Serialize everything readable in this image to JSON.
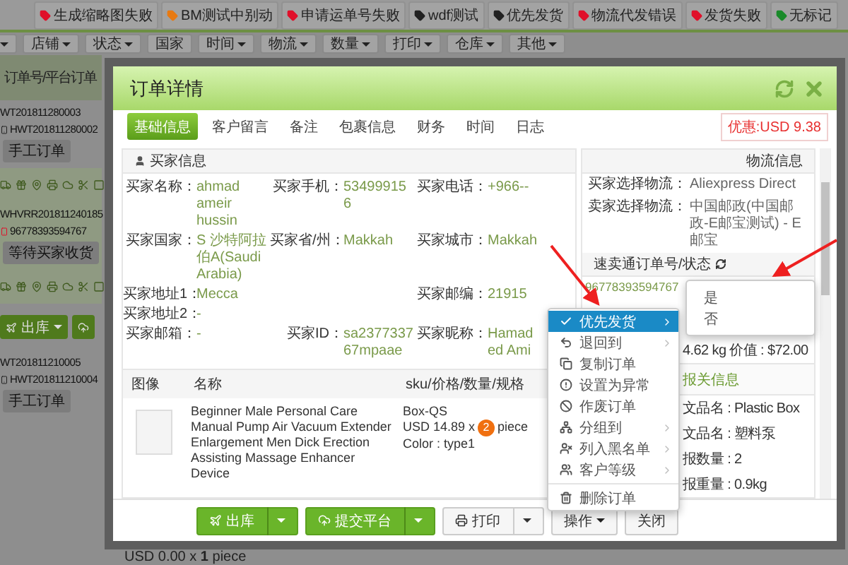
{
  "tags": [
    {
      "label": "生成缩略图失败",
      "color": "#e0102a"
    },
    {
      "label": "BM测试中别动",
      "color": "#e87a12"
    },
    {
      "label": "申请运单号失败",
      "color": "#e0102a"
    },
    {
      "label": "wdf测试",
      "color": "#222222"
    },
    {
      "label": "优先发货",
      "color": "#222222"
    },
    {
      "label": "物流代发错误",
      "color": "#e0102a"
    },
    {
      "label": "发货失败",
      "color": "#e0102a"
    },
    {
      "label": "无标记",
      "color": "#1a8a2a"
    }
  ],
  "filters": [
    {
      "has_menu": true
    },
    {
      "label": "店铺",
      "has_menu": true
    },
    {
      "label": "状态",
      "has_menu": true
    },
    {
      "label": "国家",
      "has_menu": false
    },
    {
      "label": "时间",
      "has_menu": true
    },
    {
      "label": "物流",
      "has_menu": true
    },
    {
      "label": "数量",
      "has_menu": true
    },
    {
      "label": "打印",
      "has_menu": true
    },
    {
      "label": "仓库",
      "has_menu": true
    },
    {
      "label": "其他",
      "has_menu": true
    }
  ],
  "order_list": {
    "header": "订单号/平台订单",
    "items": [
      {
        "kind": "order",
        "order_no": "WT201811280003",
        "platform_no": "HWT201811280002",
        "badge": "手工订单",
        "color": "#222222",
        "selected": false
      },
      {
        "kind": "toolbar",
        "selected": true
      },
      {
        "kind": "order",
        "order_no": "WHVRR201811240185",
        "platform_no": "96778393594767",
        "badge": "等待买家收货",
        "color": "#e0102a",
        "selected": true
      },
      {
        "kind": "toolbar",
        "selected": true
      },
      {
        "kind": "actions",
        "buttons": [
          {
            "label": "出库",
            "has_menu": true
          },
          {
            "has_menu": false
          }
        ],
        "selected": false
      },
      {
        "kind": "order",
        "order_no": "WT201811210005",
        "platform_no": "HWT201811210004",
        "badge": "手工订单",
        "color": "#222222",
        "selected": false
      }
    ]
  },
  "dialog": {
    "title": "订单详情",
    "tabs": [
      {
        "label": "基础信息",
        "selected": true
      },
      {
        "label": "客户留言",
        "selected": false
      },
      {
        "label": "备注",
        "selected": false
      },
      {
        "label": "包裹信息",
        "selected": false
      },
      {
        "label": "财务",
        "selected": false
      },
      {
        "label": "时间",
        "selected": false
      },
      {
        "label": "日志",
        "selected": false
      }
    ],
    "discount": "优惠:USD 9.38",
    "buyer": {
      "title": "买家信息",
      "rows": [
        [
          {
            "label": "买家名称：",
            "value": "ahmad ameir hussin"
          },
          {
            "label": "买家手机：",
            "value": "534999156"
          },
          {
            "label": "买家电话：",
            "value": "+966--"
          }
        ],
        [
          {
            "label": "买家国家：",
            "value": "S 沙特阿拉伯A(Saudi Arabia)"
          },
          {
            "label": "买家省/州：",
            "value": "Makkah"
          },
          {
            "label": "买家城市：",
            "value": "Makkah"
          }
        ],
        [
          {
            "label": "买家地址1：",
            "value": "Mecca"
          },
          null,
          {
            "label": "买家邮编：",
            "value": "21915"
          }
        ],
        [
          {
            "label": "买家地址2：",
            "value": "-"
          },
          null,
          null
        ],
        [
          {
            "label": "买家邮箱：",
            "value": "-"
          },
          {
            "label": "买家ID：",
            "value": "sa237733767mpaae"
          },
          {
            "label": "买家昵称：",
            "value": "Hamad ed Ami"
          }
        ]
      ]
    },
    "products": {
      "columns": [
        "图像",
        "名称",
        "sku/价格/数量/规格"
      ],
      "rows": [
        {
          "name": "Beginner Male Personal Care Manual Pump Air Vacuum Extender Enlargement Men Dick Erection Assisting Massage Enhancer Device",
          "sku": "Box-QS",
          "price": "USD 14.89 x",
          "quantity": "2",
          "unit": "piece",
          "spec": "Color : type1"
        }
      ]
    },
    "logistics": {
      "title": "物流信息",
      "fields": [
        {
          "label": "买家选择物流：",
          "value": "Aliexpress Direct"
        },
        {
          "label": "卖家选择物流：",
          "value": "中国邮政(中国邮政-E邮宝测试) - E邮宝"
        }
      ],
      "tracking_title": "速卖通订单号/状态",
      "tracking_no": "96778393594767",
      "weight": "4.62 kg 价值 : $72.00",
      "customs_title": "报关信息",
      "customs": [
        "文品名 : Plastic Box",
        "文品名 : 塑料泵",
        "报数量 : 2",
        "报重量 : 0.9kg"
      ]
    },
    "footer": [
      {
        "label": "出库",
        "kind": "green"
      },
      {
        "label": "提交平台",
        "kind": "green"
      },
      {
        "label": "打印",
        "kind": "white"
      },
      {
        "label": "操作",
        "kind": "menu"
      },
      {
        "label": "关闭",
        "kind": "plain"
      }
    ]
  },
  "context_menu": {
    "items": [
      {
        "label": "优先发货",
        "selected": true,
        "has_submenu": true
      },
      {
        "label": "退回到",
        "selected": false,
        "has_submenu": true
      },
      {
        "label": "复制订单",
        "selected": false,
        "has_submenu": false
      },
      {
        "label": "设置为异常",
        "selected": false,
        "has_submenu": false
      },
      {
        "label": "作废订单",
        "selected": false,
        "has_submenu": false
      },
      {
        "label": "分组到",
        "selected": false,
        "has_submenu": true
      },
      {
        "label": "列入黑名单",
        "selected": false,
        "has_submenu": true
      },
      {
        "label": "客户等级",
        "selected": false,
        "has_submenu": true
      },
      {
        "label": "删除订单",
        "selected": false,
        "has_submenu": false
      }
    ],
    "submenu": [
      {
        "label": "是"
      },
      {
        "label": "否"
      }
    ]
  },
  "below": "USD 0.00 x **1** piece"
}
